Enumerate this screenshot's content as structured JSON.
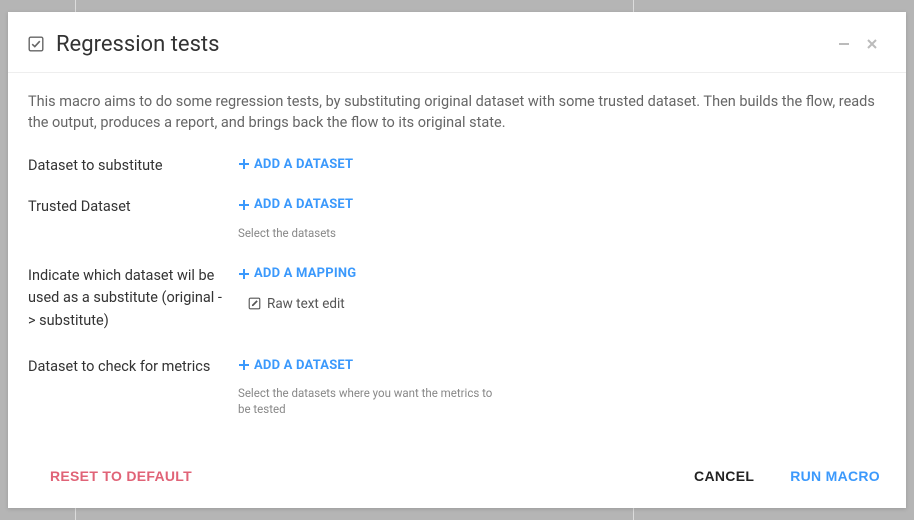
{
  "header": {
    "title": "Regression tests"
  },
  "description": "This macro aims to do some regression tests, by substituting original dataset with some trusted dataset. Then builds the flow, reads the output, produces a report, and brings back the flow to its original state.",
  "fields": {
    "datasetToSubstitute": {
      "label": "Dataset to substitute",
      "action": "ADD A DATASET"
    },
    "trustedDataset": {
      "label": "Trusted Dataset",
      "action": "ADD A DATASET",
      "helper": "Select the datasets"
    },
    "mapping": {
      "label": "Indicate which dataset wil be used as a substitute (original -> substitute)",
      "action": "ADD A MAPPING",
      "rawEdit": "Raw text edit"
    },
    "metricsDataset": {
      "label": "Dataset to check for metrics",
      "action": "ADD A DATASET",
      "helper": "Select the datasets where you want the metrics to be tested"
    }
  },
  "footer": {
    "reset": "RESET TO DEFAULT",
    "cancel": "CANCEL",
    "run": "RUN MACRO"
  }
}
